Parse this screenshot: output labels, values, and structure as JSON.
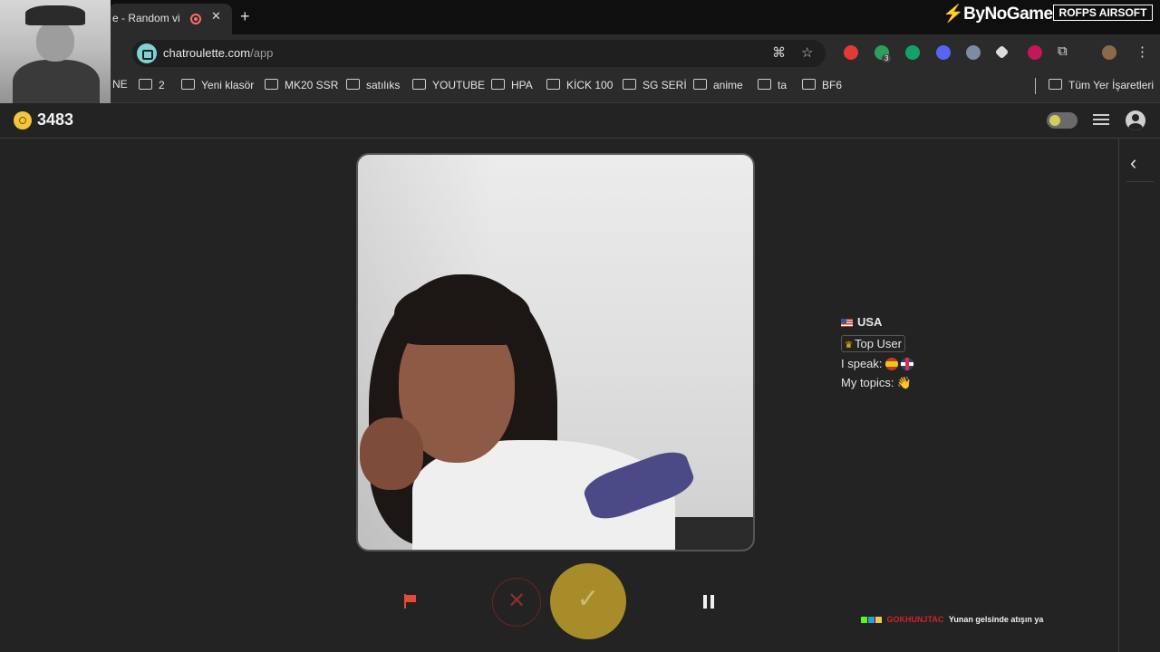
{
  "browser": {
    "tab_title": "e - Random vide",
    "new_tab_symbol": "+",
    "tab_close_symbol": "✕",
    "url_host": "chatroulette.com",
    "url_path": "/app",
    "brand_logo": "ByNoGame",
    "brand_logo_2": "ROFPS AIRSOFT",
    "extension_badge": "3",
    "bookmarks": [
      "NE",
      "2",
      "Yeni klasör",
      "MK20 SSR",
      "satılıks",
      "YOUTUBE",
      "HPA",
      "KİCK 100",
      "SG SERİ",
      "anime",
      "ta",
      "BF6"
    ],
    "all_bookmarks": "Tüm Yer İşaretleri"
  },
  "app": {
    "coins": "3483",
    "partner": {
      "country": "USA",
      "badge": "Top User",
      "speak_label": "I speak:",
      "topics_label": "My topics:",
      "topics_emoji": "👋"
    },
    "controls": {
      "skip_symbol": "✕",
      "accept_symbol": "✓"
    },
    "side_toggle": "‹"
  },
  "stream_overlay": {
    "chat_user": "GOKHUNJTAC",
    "chat_message": "Yunan gelsinde atışın ya"
  },
  "icons": [
    "translate-icon",
    "star-icon",
    "extension-icon",
    "coin-icon",
    "settings-sliders-icon",
    "profile-icon",
    "report-flag-icon",
    "pause-icon"
  ],
  "colors": {
    "accent_gold": "#a88c2a",
    "coin": "#f4c63d",
    "report_red": "#e34b35",
    "background": "#232323"
  }
}
